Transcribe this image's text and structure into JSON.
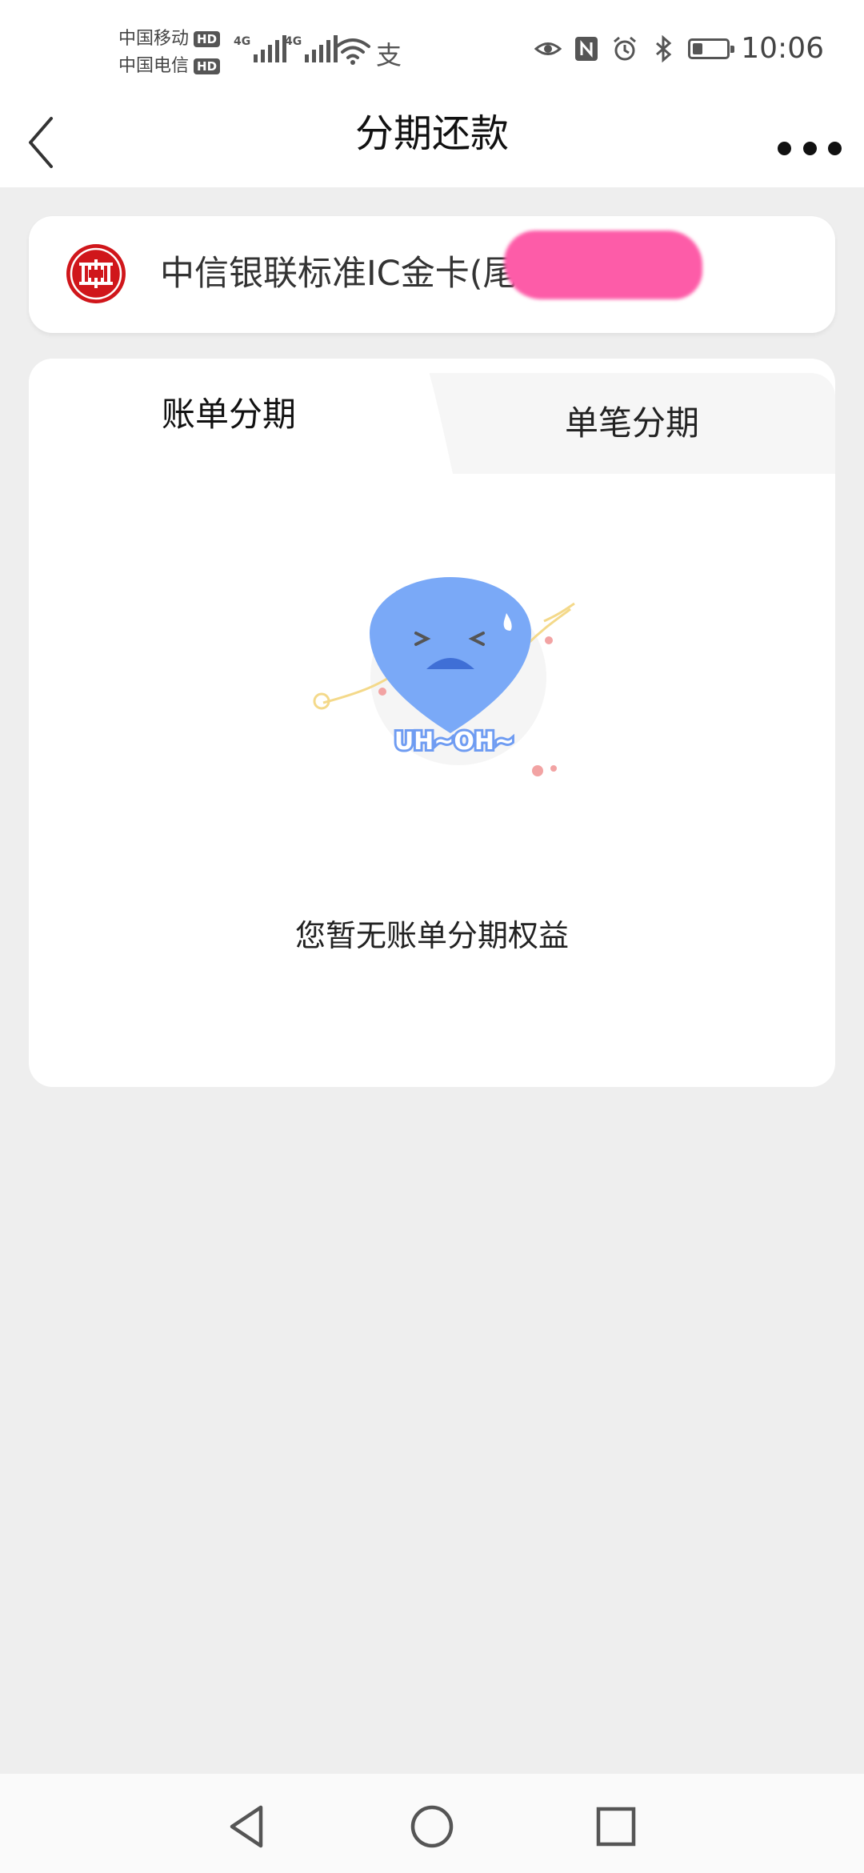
{
  "status_bar": {
    "carrier_1": "中国移动",
    "carrier_2": "中国电信",
    "hd_badge": "HD",
    "network_1": "4G",
    "network_2": "4G",
    "time": "10:06",
    "battery_level": 0.3,
    "icons": [
      "wifi-icon",
      "alipay-icon",
      "eye-icon",
      "nfc-icon",
      "alarm-icon",
      "bluetooth-icon",
      "battery-icon"
    ]
  },
  "navbar": {
    "title": "分期还款",
    "back_icon": "chevron-left-icon",
    "more_icon": "more-dots-icon"
  },
  "card": {
    "name": "中信银联标准IC金卡(尾号",
    "logo": "citic-bank-logo"
  },
  "tabs": [
    {
      "label": "账单分期",
      "active": true
    },
    {
      "label": "单笔分期",
      "active": false
    }
  ],
  "empty_state": {
    "illustration_text": "UH~OH~",
    "message": "您暂无账单分期权益"
  },
  "colors": {
    "mascot_blue": "#7aa9f7",
    "redaction_pink": "#fd5ca8",
    "logo_red": "#d0161b",
    "background": "#eeeeee"
  },
  "system_nav": [
    "back-triangle-icon",
    "home-circle-icon",
    "recents-square-icon"
  ]
}
